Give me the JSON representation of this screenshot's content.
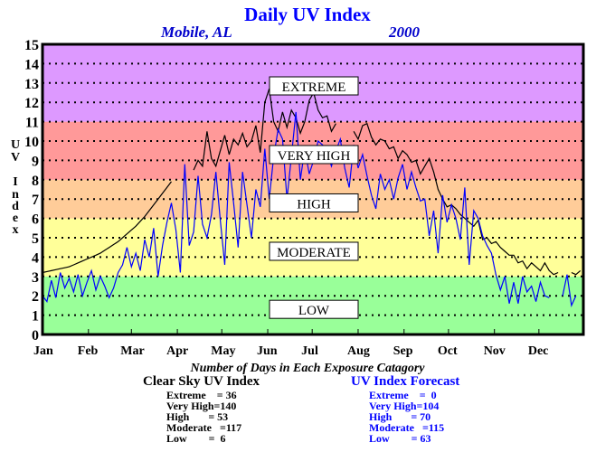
{
  "header": {
    "title": "Daily UV Index",
    "location": "Mobile, AL",
    "year": "2000"
  },
  "chart_data": {
    "type": "line",
    "title": "Daily UV Index",
    "subtitle": "Mobile, AL   2000",
    "xlabel": "",
    "ylabel": "UV Index",
    "ylim": [
      0,
      15
    ],
    "yticks": [
      0,
      1,
      2,
      3,
      4,
      5,
      6,
      7,
      8,
      9,
      10,
      11,
      12,
      13,
      14,
      15
    ],
    "xlim_days": [
      1,
      366
    ],
    "xticks": [
      {
        "label": "Jan",
        "day": 1
      },
      {
        "label": "Feb",
        "day": 32
      },
      {
        "label": "Mar",
        "day": 61
      },
      {
        "label": "Apr",
        "day": 92
      },
      {
        "label": "May",
        "day": 122
      },
      {
        "label": "Jun",
        "day": 153
      },
      {
        "label": "Jul",
        "day": 183
      },
      {
        "label": "Aug",
        "day": 214
      },
      {
        "label": "Sep",
        "day": 245
      },
      {
        "label": "Oct",
        "day": 275
      },
      {
        "label": "Nov",
        "day": 306
      },
      {
        "label": "Dec",
        "day": 336
      }
    ],
    "grid": "horizontal dotted",
    "bands": [
      {
        "name": "LOW",
        "from": 0,
        "to": 3,
        "color": "#99ff99"
      },
      {
        "name": "MODERATE",
        "from": 3,
        "to": 6,
        "color": "#ffff99"
      },
      {
        "name": "HIGH",
        "from": 6,
        "to": 8,
        "color": "#ffcc99"
      },
      {
        "name": "VERY HIGH",
        "from": 8,
        "to": 11,
        "color": "#ff9999"
      },
      {
        "name": "EXTREME",
        "from": 11,
        "to": 15,
        "color": "#dd99ff"
      }
    ],
    "band_labels": [
      {
        "text": "EXTREME",
        "y": 12.85
      },
      {
        "text": "VERY HIGH",
        "y": 9.3
      },
      {
        "text": "HIGH",
        "y": 6.8
      },
      {
        "text": "MODERATE",
        "y": 4.3
      },
      {
        "text": "LOW",
        "y": 1.3
      }
    ],
    "sample_interval_days": 3,
    "series": [
      {
        "name": "Clear Sky UV Index",
        "color": "#000000",
        "start_day": 1,
        "values": [
          3.2,
          3.25,
          3.3,
          3.35,
          3.4,
          3.45,
          3.5,
          3.6,
          3.7,
          3.8,
          3.9,
          4.0,
          4.1,
          4.2,
          4.35,
          4.5,
          4.65,
          4.8,
          5.0,
          5.2,
          5.4,
          5.6,
          5.85,
          6.1,
          6.4,
          6.7,
          7.0,
          7.3,
          7.6,
          7.9,
          null,
          7.8,
          null,
          null,
          8.5,
          9.0,
          8.7,
          10.5,
          9.1,
          8.7,
          9.5,
          10.3,
          9.3,
          10.1,
          9.8,
          10.4,
          9.7,
          10.0,
          10.8,
          9.4,
          12.0,
          12.7,
          11.0,
          10.5,
          11.5,
          10.7,
          11.6,
          11.2,
          10.4,
          11.0,
          12.1,
          12.5,
          11.6,
          11.2,
          11.3,
          10.5,
          10.9,
          null,
          11.3,
          null,
          10.5,
          10.1,
          10.8,
          10.9,
          10.2,
          9.8,
          10.1,
          10.0,
          9.6,
          9.7,
          9.1,
          9.5,
          9.3,
          8.9,
          9.0,
          8.3,
          8.7,
          9.1,
          8.4,
          7.5,
          7.0,
          6.6,
          6.7,
          6.5,
          6.2,
          6.0,
          5.8,
          5.6,
          5.9,
          4.9,
          5.0,
          4.7,
          4.8,
          4.5,
          4.3,
          4.1,
          4.1,
          3.7,
          3.8,
          3.4,
          3.7,
          3.5,
          3.3,
          3.7,
          3.3,
          3.1,
          3.2,
          null,
          null,
          3.2,
          3.1,
          3.3
        ]
      },
      {
        "name": "UV Index Forecast",
        "color": "#0000ff",
        "start_day": 1,
        "values": [
          2.0,
          1.7,
          2.8,
          1.9,
          3.2,
          2.4,
          2.9,
          2.2,
          3.1,
          2.0,
          2.7,
          3.3,
          2.3,
          3.0,
          2.5,
          1.9,
          2.4,
          3.2,
          3.6,
          4.5,
          3.5,
          4.2,
          3.3,
          4.9,
          4.0,
          5.5,
          3.0,
          4.6,
          5.8,
          6.8,
          5.4,
          3.2,
          8.8,
          4.6,
          5.3,
          8.2,
          5.7,
          5.0,
          6.2,
          8.4,
          5.9,
          3.6,
          8.9,
          6.8,
          4.5,
          8.4,
          6.7,
          5.0,
          7.5,
          6.6,
          9.6,
          7.0,
          9.2,
          10.6,
          10.1,
          7.0,
          9.2,
          11.5,
          8.0,
          9.6,
          8.3,
          9.0,
          10.0,
          9.8,
          9.4,
          8.7,
          9.5,
          10.1,
          8.6,
          7.6,
          9.8,
          8.6,
          9.3,
          8.2,
          7.2,
          6.5,
          8.3,
          7.5,
          8.0,
          7.0,
          8.1,
          8.8,
          7.5,
          8.4,
          7.6,
          6.9,
          7.0,
          5.1,
          6.4,
          4.2,
          7.2,
          5.8,
          6.7,
          6.0,
          4.9,
          7.6,
          3.6,
          6.4,
          6.0,
          5.1,
          4.6,
          4.2,
          3.1,
          2.3,
          3.0,
          1.6,
          2.7,
          1.6,
          3.0,
          2.2,
          2.5,
          1.7,
          2.7,
          2.0,
          1.9,
          null,
          null,
          2.0,
          3.1,
          1.5,
          2.0
        ]
      }
    ]
  },
  "summary": {
    "title": "Number of Days in Each Exposure Catagory",
    "clear_sky": {
      "heading": "Clear Sky UV Index",
      "rows": [
        {
          "label": "Extreme",
          "value": "36"
        },
        {
          "label": "Very High",
          "value": "140"
        },
        {
          "label": "High",
          "value": "53"
        },
        {
          "label": "Moderate",
          "value": "117"
        },
        {
          "label": "Low",
          "value": "6"
        }
      ]
    },
    "forecast": {
      "heading": "UV Index Forecast",
      "rows": [
        {
          "label": "Extreme",
          "value": "0"
        },
        {
          "label": "Very High",
          "value": "104"
        },
        {
          "label": "High",
          "value": "70"
        },
        {
          "label": "Moderate",
          "value": "115"
        },
        {
          "label": "Low",
          "value": "63"
        }
      ]
    }
  }
}
